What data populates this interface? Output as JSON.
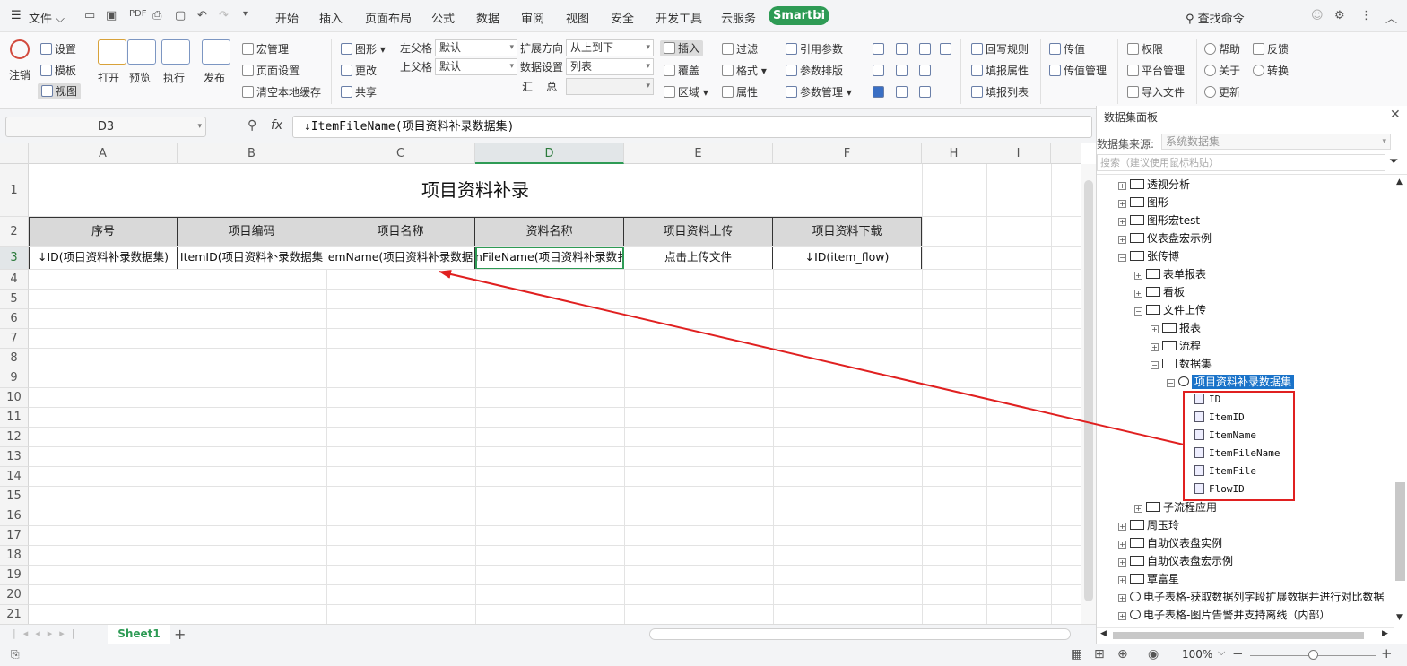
{
  "menubar": {
    "file_label": "文件",
    "items": [
      "开始",
      "插入",
      "页面布局",
      "公式",
      "数据",
      "审阅",
      "视图",
      "安全",
      "开发工具",
      "云服务"
    ],
    "smartbi_label": "Smartbi",
    "search_label": "查找命令"
  },
  "ribbon": {
    "logout": "注销",
    "settings": "设置",
    "template": "模板",
    "view": "视图",
    "open": "打开",
    "preview": "预览",
    "execute": "执行",
    "publish": "发布",
    "macro": "宏管理",
    "page_setup": "页面设置",
    "clear_cache": "清空本地缓存",
    "graphic": "图形",
    "change": "更改",
    "share": "共享",
    "left_parent_label": "左父格",
    "left_parent_value": "默认",
    "top_parent_label": "上父格",
    "top_parent_value": "默认",
    "expand_dir_label": "扩展方向",
    "expand_dir_value": "从上到下",
    "data_setting_label": "数据设置",
    "data_setting_value": "列表",
    "summary_label": "汇    总",
    "insert": "插入",
    "cover": "覆盖",
    "region": "区域",
    "filter": "过滤",
    "format": "格式",
    "property": "属性",
    "ref_param": "引用参数",
    "param_layout": "参数排版",
    "param_mgmt": "参数管理",
    "writeback_rule": "回写规则",
    "fill_property": "填报属性",
    "fill_list": "填报列表",
    "pass_value": "传值",
    "pass_value_mgmt": "传值管理",
    "permission": "权限",
    "platform_mgmt": "平台管理",
    "import_file": "导入文件",
    "help": "帮助",
    "about": "关于",
    "update": "更新",
    "feedback": "反馈",
    "convert": "转换"
  },
  "formula_bar": {
    "cell_ref": "D3",
    "fx": "fx",
    "formula": "↓ItemFileName(项目资料补录数据集)"
  },
  "sheet": {
    "columns": [
      "A",
      "B",
      "C",
      "D",
      "E",
      "F",
      "H",
      "I"
    ],
    "rows": [
      "1",
      "2",
      "3",
      "4",
      "5",
      "6",
      "7",
      "8",
      "9",
      "10",
      "11",
      "12",
      "13",
      "14",
      "15",
      "16",
      "17",
      "18",
      "19",
      "20",
      "21"
    ],
    "title": "项目资料补录",
    "headers": [
      "序号",
      "项目编码",
      "项目名称",
      "资料名称",
      "项目资料上传",
      "项目资料下载"
    ],
    "data_row": [
      "↓ID(项目资料补录数据集)",
      "ItemID(项目资料补录数据集",
      "emName(项目资料补录数据",
      "nFileName(项目资料补录数扌",
      "点击上传文件",
      "↓ID(item_flow)"
    ],
    "tab": "Sheet1",
    "add_tab": "+"
  },
  "panel": {
    "title": "数据集面板",
    "source_label": "数据集来源:",
    "source_value": "系统数据集",
    "search_placeholder": "搜索（建议使用鼠标粘贴）",
    "tree": [
      {
        "label": "透视分析",
        "toggle": "+"
      },
      {
        "label": "图形",
        "toggle": "+"
      },
      {
        "label": "图形宏test",
        "toggle": "+"
      },
      {
        "label": "仪表盘宏示例",
        "toggle": "+"
      },
      {
        "label": "张传博",
        "toggle": "−"
      },
      {
        "label": "表单报表",
        "toggle": "+"
      },
      {
        "label": "看板",
        "toggle": "+"
      },
      {
        "label": "文件上传",
        "toggle": "−"
      },
      {
        "label": "报表",
        "toggle": "+"
      },
      {
        "label": "流程",
        "toggle": "+"
      },
      {
        "label": "数据集",
        "toggle": "−"
      },
      {
        "label": "项目资料补录数据集",
        "toggle": "−"
      },
      {
        "label": "ID",
        "toggle": ""
      },
      {
        "label": "ItemID",
        "toggle": ""
      },
      {
        "label": "ItemName",
        "toggle": ""
      },
      {
        "label": "ItemFileName",
        "toggle": ""
      },
      {
        "label": "ItemFile",
        "toggle": ""
      },
      {
        "label": "FlowID",
        "toggle": ""
      },
      {
        "label": "子流程应用",
        "toggle": "+"
      },
      {
        "label": "周玉玲",
        "toggle": "+"
      },
      {
        "label": "自助仪表盘实例",
        "toggle": "+"
      },
      {
        "label": "自助仪表盘宏示例",
        "toggle": "+"
      },
      {
        "label": "覃富星",
        "toggle": "+"
      },
      {
        "label": "电子表格-获取数据列字段扩展数据并进行对比数据",
        "toggle": "+"
      },
      {
        "label": "电子表格-图片告警并支持离线（内部）",
        "toggle": "+"
      }
    ]
  },
  "status": {
    "zoom": "100%"
  },
  "colors": {
    "accent_green": "#2e9b55",
    "annotation_red": "#e02020",
    "tree_selected": "#1a73c9"
  }
}
